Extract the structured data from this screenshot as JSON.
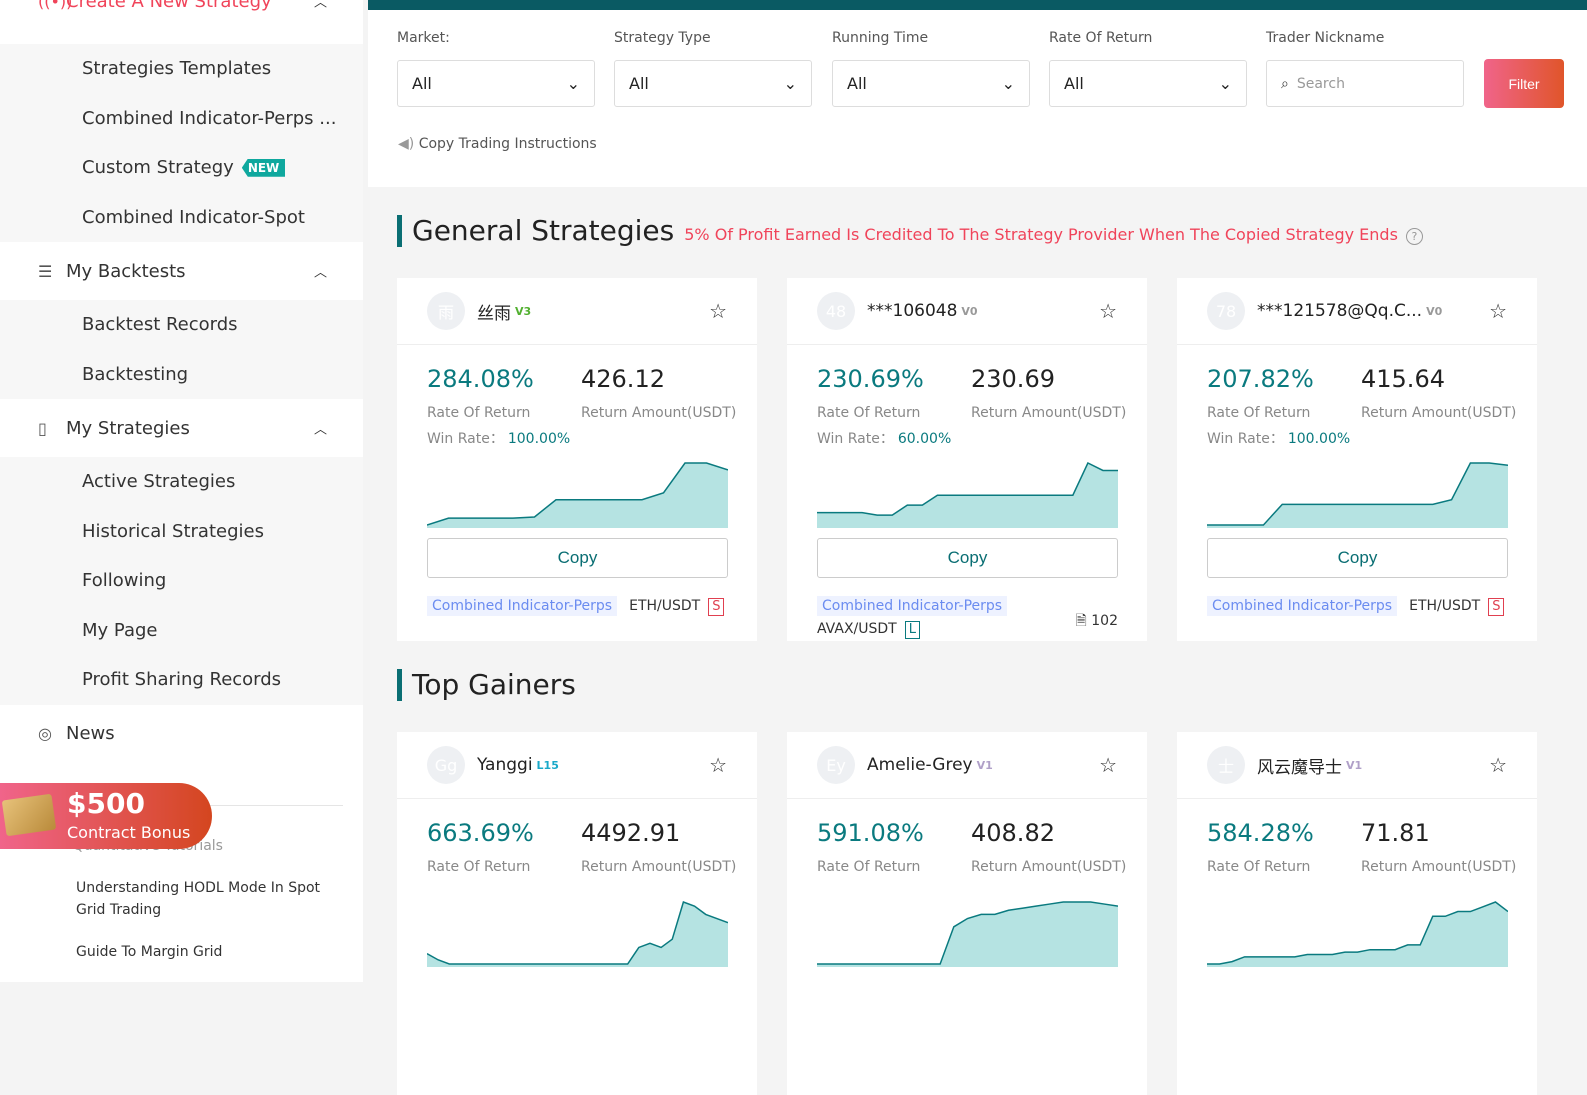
{
  "sidebar": {
    "create": {
      "label": "Create A New Strategy",
      "items": [
        "Strategies Templates",
        "Combined Indicator-Perps ...",
        "Custom Strategy",
        "Combined Indicator-Spot"
      ],
      "new_badge": "NEW"
    },
    "backtests": {
      "label": "My Backtests",
      "items": [
        "Backtest Records",
        "Backtesting"
      ]
    },
    "strategies": {
      "label": "My Strategies",
      "items": [
        "Active Strategies",
        "Historical Strategies",
        "Following",
        "My Page",
        "Profit Sharing Records"
      ]
    },
    "news": "News",
    "promo": {
      "amount": "$500",
      "label": "Contract Bonus"
    },
    "tutorials": {
      "label": "Quantitative Tutorials",
      "items": [
        "Understanding HODL Mode In Spot Grid Trading",
        "Guide To Margin Grid"
      ]
    }
  },
  "filters": {
    "market": {
      "label": "Market:",
      "value": "All"
    },
    "type": {
      "label": "Strategy Type",
      "value": "All"
    },
    "time": {
      "label": "Running Time",
      "value": "All"
    },
    "ror": {
      "label": "Rate Of Return",
      "value": "All"
    },
    "nick": {
      "label": "Trader Nickname",
      "placeholder": "Search"
    },
    "filter_btn": "Filter",
    "instructions": "Copy Trading Instructions"
  },
  "general": {
    "title": "General Strategies",
    "note": "5% Of Profit Earned Is Credited To The Strategy Provider When The Copied Strategy Ends"
  },
  "gainers": {
    "title": "Top Gainers"
  },
  "labels": {
    "ror": "Rate Of Return",
    "amount": "Return Amount(USDT)",
    "win": "Win Rate：",
    "copy": "Copy"
  },
  "colors": {
    "accent": "#0a7a7f",
    "chart_fill": "#b5e3e2",
    "alert": "#f0445a"
  },
  "general_cards": [
    {
      "avatar": "雨",
      "name": "丝雨",
      "badge": "V3",
      "badge_color": "#52b030",
      "ror": "284.08%",
      "amount": "426.12",
      "win": "100.00%",
      "tag": "Combined Indicator-Perps",
      "pair": "ETH/USDT",
      "dir": "S",
      "spark": [
        0,
        3,
        3,
        3,
        3,
        3.5,
        11,
        11,
        11,
        11,
        11,
        14,
        27,
        27,
        24
      ]
    },
    {
      "avatar": "48",
      "name": "***106048",
      "badge": "V0",
      "badge_color": "#999",
      "ror": "230.69%",
      "amount": "230.69",
      "win": "60.00%",
      "tag": "Combined Indicator-Perps",
      "pair": "AVAX/USDT",
      "dir": "L",
      "count": "102",
      "spark": [
        5,
        5,
        5,
        5,
        4,
        4,
        8,
        8,
        12,
        12,
        12,
        12,
        12,
        12,
        12,
        12,
        12,
        12,
        25,
        22,
        22
      ]
    },
    {
      "avatar": "78",
      "name": "***121578@Qq.C...",
      "badge": "V0",
      "badge_color": "#999",
      "ror": "207.82%",
      "amount": "415.64",
      "win": "100.00%",
      "tag": "Combined Indicator-Perps",
      "pair": "ETH/USDT",
      "dir": "S",
      "spark": [
        0,
        0,
        0,
        0,
        9,
        9,
        9,
        9,
        9,
        9,
        9,
        9,
        9,
        11,
        27,
        27,
        26
      ]
    }
  ],
  "gainer_cards": [
    {
      "avatar": "Gg",
      "name": "Yanggi",
      "badge": "L15",
      "badge_color": "#1aa9c9",
      "ror": "663.69%",
      "amount": "4492.91",
      "spark": [
        5,
        2,
        0,
        0,
        0,
        0,
        0,
        0,
        0,
        0,
        0,
        0,
        0,
        0,
        0,
        0,
        0,
        0,
        0,
        8,
        10,
        8,
        12,
        30,
        28,
        24,
        22,
        20
      ]
    },
    {
      "avatar": "Ey",
      "name": "Amelie-Grey",
      "badge": "V1",
      "badge_color": "#b0a0c8",
      "ror": "591.08%",
      "amount": "408.82",
      "spark": [
        0,
        0,
        0,
        0,
        0,
        0,
        0,
        0,
        0,
        0,
        18,
        22,
        24,
        24,
        26,
        27,
        28,
        29,
        30,
        30,
        30,
        29,
        28
      ]
    },
    {
      "avatar": "士",
      "name": "风云魔导士",
      "badge": "V1",
      "badge_color": "#b0a0c8",
      "ror": "584.28%",
      "amount": "71.81",
      "spark": [
        0,
        0,
        1,
        3,
        3,
        3,
        3,
        3,
        4,
        4,
        4,
        5,
        5,
        6,
        6,
        6,
        8,
        8,
        20,
        20,
        22,
        22,
        24,
        26,
        22
      ]
    }
  ]
}
